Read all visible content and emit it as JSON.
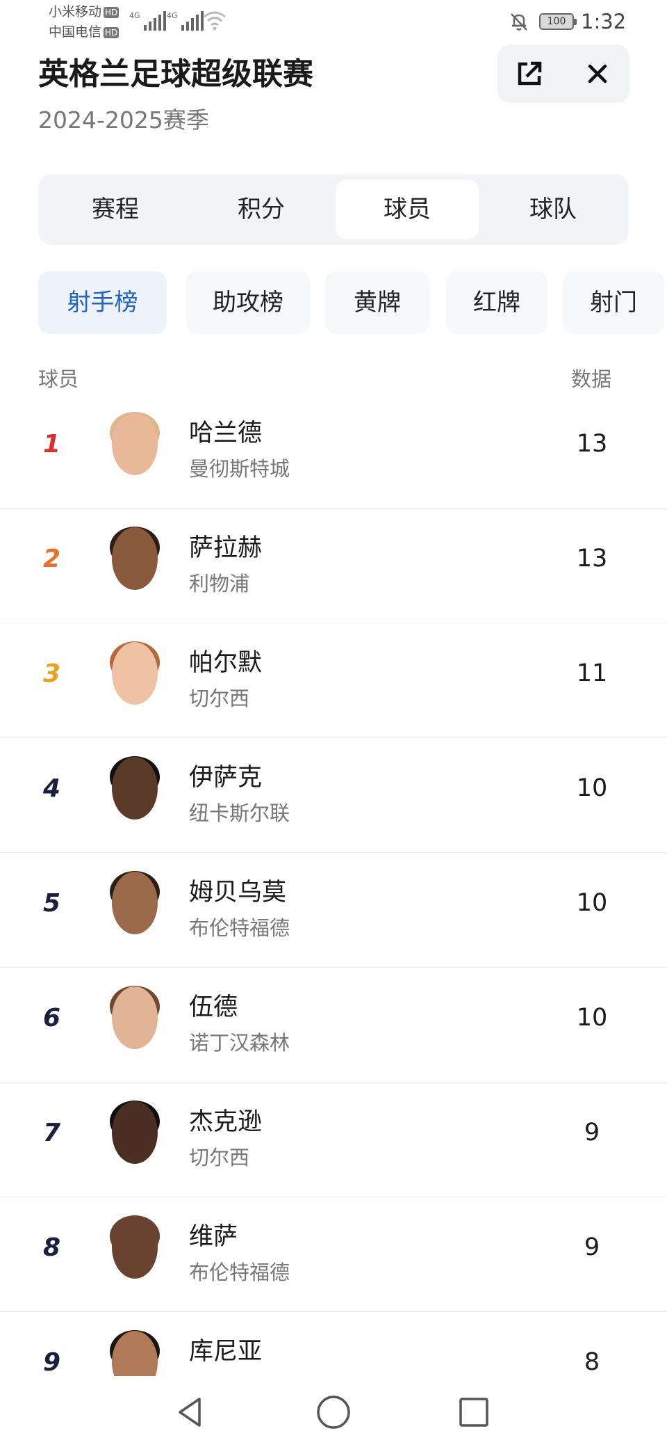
{
  "status_bar": {
    "carrier1": "小米移动",
    "carrier2": "中国电信",
    "hd": "HD",
    "network": "4G",
    "battery": "100",
    "time": "1:32"
  },
  "header": {
    "title": "英格兰足球超级联赛",
    "season": "2024-2025赛季"
  },
  "tabs": [
    "赛程",
    "积分",
    "球员",
    "球队"
  ],
  "active_tab": "球员",
  "sub_tabs": [
    "射手榜",
    "助攻榜",
    "黄牌",
    "红牌",
    "射门"
  ],
  "active_sub_tab": "射手榜",
  "columns": {
    "player": "球员",
    "data": "数据"
  },
  "players": [
    {
      "rank": "1",
      "name": "哈兰德",
      "team": "曼彻斯特城",
      "value": "13",
      "rank_color": "#d9302c",
      "skin": "#e8b899",
      "hair": "#d9b98a"
    },
    {
      "rank": "2",
      "name": "萨拉赫",
      "team": "利物浦",
      "value": "13",
      "rank_color": "#e8702a",
      "skin": "#8a5a3c",
      "hair": "#2a1d15"
    },
    {
      "rank": "3",
      "name": "帕尔默",
      "team": "切尔西",
      "value": "11",
      "rank_color": "#e8a21c",
      "skin": "#f0c2a5",
      "hair": "#b5683a"
    },
    {
      "rank": "4",
      "name": "伊萨克",
      "team": "纽卡斯尔联",
      "value": "10",
      "rank_color": "#1b1f3b",
      "skin": "#5a3a28",
      "hair": "#111111"
    },
    {
      "rank": "5",
      "name": "姆贝乌莫",
      "team": "布伦特福德",
      "value": "10",
      "rank_color": "#1b1f3b",
      "skin": "#9a6a4a",
      "hair": "#2c2016"
    },
    {
      "rank": "6",
      "name": "伍德",
      "team": "诺丁汉森林",
      "value": "10",
      "rank_color": "#1b1f3b",
      "skin": "#e2b496",
      "hair": "#6b4a30"
    },
    {
      "rank": "7",
      "name": "杰克逊",
      "team": "切尔西",
      "value": "9",
      "rank_color": "#1b1f3b",
      "skin": "#4a2f22",
      "hair": "#0f0f0f"
    },
    {
      "rank": "8",
      "name": "维萨",
      "team": "布伦特福德",
      "value": "9",
      "rank_color": "#1b1f3b",
      "skin": "#6a4330",
      "hair": "#6a4330"
    },
    {
      "rank": "9",
      "name": "库尼亚",
      "team": "",
      "value": "8",
      "rank_color": "#1b1f3b",
      "skin": "#b07a58",
      "hair": "#1c1410"
    }
  ],
  "colors": {
    "accent": "#1f63c6",
    "active_chip_bg": "#eef3fb",
    "segment_bg": "#f3f4f8"
  },
  "nav": {
    "back": "back-icon",
    "home": "home-icon",
    "recents": "recents-icon"
  }
}
